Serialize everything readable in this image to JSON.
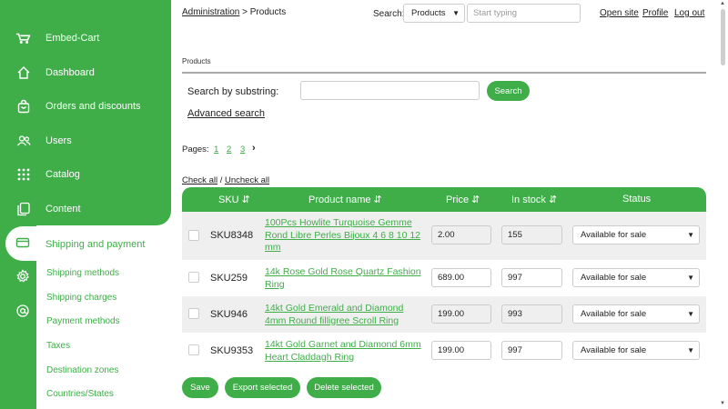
{
  "brand": {
    "name": "Embed-Cart",
    "accent": "#3fae49"
  },
  "sidebar": {
    "items": [
      {
        "label": "Dashboard",
        "icon": "home-icon"
      },
      {
        "label": "Orders and discounts",
        "icon": "bag-icon"
      },
      {
        "label": "Users",
        "icon": "users-icon"
      },
      {
        "label": "Catalog",
        "icon": "grid-icon"
      },
      {
        "label": "Content",
        "icon": "pages-icon"
      },
      {
        "label": "Shipping and payment",
        "icon": "card-icon",
        "active": true
      }
    ],
    "submenu": [
      "Shipping methods",
      "Shipping charges",
      "Payment methods",
      "Taxes",
      "Destination zones",
      "Countries/States"
    ]
  },
  "topbar": {
    "breadcrumb_link": "Administration",
    "breadcrumb_rest": " > Products",
    "search_label": "Search:",
    "search_scope": "Products",
    "search_placeholder": "Start typing",
    "links": [
      "Open site",
      "Profile",
      "Log out"
    ]
  },
  "panel": {
    "title": "Products",
    "substring_label": "Search by substring:",
    "search_button": "Search",
    "advanced_search": "Advanced search",
    "pages_label": "Pages:",
    "pages": [
      "1",
      "2",
      "3"
    ],
    "check_all": "Check all",
    "separator": " / ",
    "uncheck_all": "Uncheck all"
  },
  "table": {
    "headers": [
      "SKU",
      "Product name",
      "Price",
      "In stock",
      "Status"
    ],
    "rows": [
      {
        "sku": "SKU8348",
        "name": "100Pcs Howlite Turquoise Gemme Rond Libre Perles Bijoux 4 6 8 10 12 mm",
        "price": "2.00",
        "stock": "155",
        "status": "Available for sale"
      },
      {
        "sku": "SKU259",
        "name": "14k Rose Gold Rose Quartz Fashion Ring",
        "price": "689.00",
        "stock": "997",
        "status": "Available for sale"
      },
      {
        "sku": "SKU946",
        "name": "14kt Gold Emerald and Diamond 4mm Round filligree Scroll Ring",
        "price": "199.00",
        "stock": "993",
        "status": "Available for sale"
      },
      {
        "sku": "SKU9353",
        "name": "14kt Gold Garnet and Diamond 6mm Heart Claddagh Ring",
        "price": "199.00",
        "stock": "997",
        "status": "Available for sale"
      }
    ]
  },
  "actions": {
    "save": "Save",
    "export": "Export selected",
    "delete": "Delete selected"
  }
}
